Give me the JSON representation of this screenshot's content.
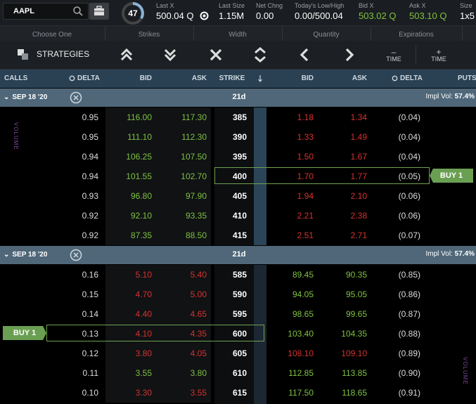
{
  "header": {
    "symbol": "AAPL",
    "score": "47",
    "quotes": [
      {
        "label": "Last X",
        "value": "500.04 Q"
      },
      {
        "label": "Last Size",
        "value": "1.15M"
      },
      {
        "label": "Net Chng",
        "value": "0.00"
      },
      {
        "label": "Today's Low/High",
        "value": "0.00/500.04"
      },
      {
        "label": "Bid X",
        "value": "503.02 Q"
      },
      {
        "label": "Ask X",
        "value": "503.10 Q"
      },
      {
        "label": "Size",
        "value": "1x5"
      }
    ]
  },
  "toolbar": {
    "groups": [
      "Choose One",
      "Strikes",
      "Width",
      "Quantity",
      "Expirations"
    ],
    "strategies_label": "STRATEGIES",
    "time_minus": "TIME",
    "time_plus": "TIME",
    "minus": "–",
    "plus": "+"
  },
  "columns": {
    "calls": "CALLS",
    "delta": "DELTA",
    "bid": "BID",
    "ask": "ASK",
    "strike": "STRIKE",
    "put_bid": "BID",
    "put_ask": "ASK",
    "put_delta": "DELTA",
    "puts": "PUTS"
  },
  "sections": [
    {
      "date": "SEP 18 '20",
      "dte": "21d",
      "impl_vol_label": "Impl Vol:",
      "impl_vol": "57.4%",
      "volume_label": "VOLUME",
      "buy_label": "BUY 1",
      "selected_strike": "400",
      "buy_side": "put",
      "rows": [
        {
          "delta": "0.95",
          "bid": "116.00",
          "ask": "117.30",
          "strike": "385",
          "pbid": "1.18",
          "pask": "1.34",
          "pdelta": "(0.04)"
        },
        {
          "delta": "0.95",
          "bid": "111.10",
          "ask": "112.30",
          "strike": "390",
          "pbid": "1.33",
          "pask": "1.49",
          "pdelta": "(0.04)"
        },
        {
          "delta": "0.94",
          "bid": "106.25",
          "ask": "107.50",
          "strike": "395",
          "pbid": "1.50",
          "pask": "1.67",
          "pdelta": "(0.04)"
        },
        {
          "delta": "0.94",
          "bid": "101.55",
          "ask": "102.70",
          "strike": "400",
          "pbid": "1.70",
          "pask": "1.77",
          "pdelta": "(0.05)"
        },
        {
          "delta": "0.93",
          "bid": "96.80",
          "ask": "97.90",
          "strike": "405",
          "pbid": "1.94",
          "pask": "2.10",
          "pdelta": "(0.06)"
        },
        {
          "delta": "0.92",
          "bid": "92.10",
          "ask": "93.35",
          "strike": "410",
          "pbid": "2.21",
          "pask": "2.38",
          "pdelta": "(0.06)"
        },
        {
          "delta": "0.92",
          "bid": "87.35",
          "ask": "88.50",
          "strike": "415",
          "pbid": "2.51",
          "pask": "2.71",
          "pdelta": "(0.07)"
        }
      ]
    },
    {
      "date": "SEP 18 '20",
      "dte": "21d",
      "impl_vol_label": "Impl Vol:",
      "impl_vol": "57.4%",
      "volume_label": "VOLUME",
      "buy_label": "BUY 1",
      "selected_strike": "600",
      "buy_side": "call",
      "rows": [
        {
          "delta": "0.16",
          "bid": "5.10",
          "ask": "5.40",
          "strike": "585",
          "pbid": "89.45",
          "pask": "90.35",
          "pdelta": "(0.85)"
        },
        {
          "delta": "0.15",
          "bid": "4.70",
          "ask": "5.00",
          "strike": "590",
          "pbid": "94.05",
          "pask": "95.05",
          "pdelta": "(0.86)"
        },
        {
          "delta": "0.14",
          "bid": "4.40",
          "ask": "4.65",
          "strike": "595",
          "pbid": "98.65",
          "pask": "99.65",
          "pdelta": "(0.87)"
        },
        {
          "delta": "0.13",
          "bid": "4.10",
          "ask": "4.35",
          "strike": "600",
          "pbid": "103.40",
          "pask": "104.35",
          "pdelta": "(0.88)"
        },
        {
          "delta": "0.12",
          "bid": "3.80",
          "ask": "4.05",
          "strike": "605",
          "pbid": "108.10",
          "pask": "109.10",
          "pdelta": "(0.89)"
        },
        {
          "delta": "0.11",
          "bid": "3.55",
          "ask": "3.80",
          "strike": "610",
          "pbid": "112.85",
          "pask": "113.85",
          "pdelta": "(0.90)"
        },
        {
          "delta": "0.10",
          "bid": "3.30",
          "ask": "3.55",
          "strike": "615",
          "pbid": "117.50",
          "pask": "118.65",
          "pdelta": "(0.91)"
        }
      ]
    }
  ],
  "colors": {
    "green": "#7fc241",
    "red": "#d6322f",
    "header_blue": "#2a4154",
    "section": "#4f6779"
  },
  "icons": [
    "search-icon",
    "briefcase-icon",
    "strategies-icon",
    "chevrons-up-icon",
    "chevrons-down-icon",
    "close-x-icon",
    "expand-icon",
    "chevron-left-icon",
    "chevron-right-icon",
    "sort-icon",
    "delta-circle-icon",
    "close-circle-icon"
  ]
}
